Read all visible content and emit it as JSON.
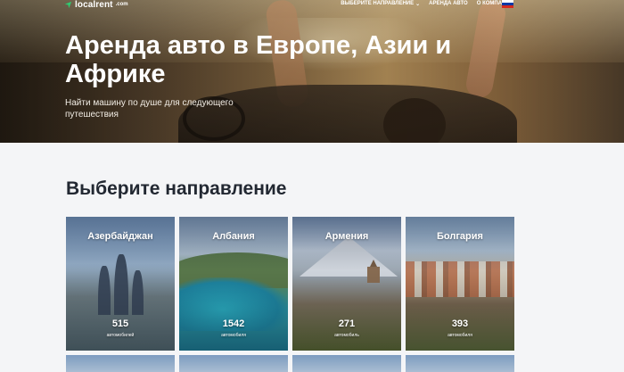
{
  "header": {
    "logo_text": "localrent",
    "logo_suffix": ".com",
    "nav": [
      {
        "label": "Выберите направление",
        "has_dropdown": true
      },
      {
        "label": "Аренда авто",
        "has_dropdown": false
      },
      {
        "label": "О компании",
        "has_dropdown": false
      }
    ],
    "language_flag": "russian-flag-icon",
    "flag_colors": [
      "#ffffff",
      "#0039a6",
      "#d52b1e"
    ]
  },
  "hero": {
    "title": "Аренда авто в Европе, Азии и Африке",
    "subtitle": "Найти машину по душе для следующего путешествия"
  },
  "destinations_section": {
    "title": "Выберите направление",
    "cards": [
      {
        "name": "Азербайджан",
        "count": "515",
        "unit": "автомобилей"
      },
      {
        "name": "Албания",
        "count": "1542",
        "unit": "автомобиля"
      },
      {
        "name": "Армения",
        "count": "271",
        "unit": "автомобиль"
      },
      {
        "name": "Болгария",
        "count": "393",
        "unit": "автомобиля"
      }
    ]
  },
  "colors": {
    "brand_green": "#2ecc71",
    "heading_dark": "#222832",
    "background": "#f4f5f7"
  }
}
